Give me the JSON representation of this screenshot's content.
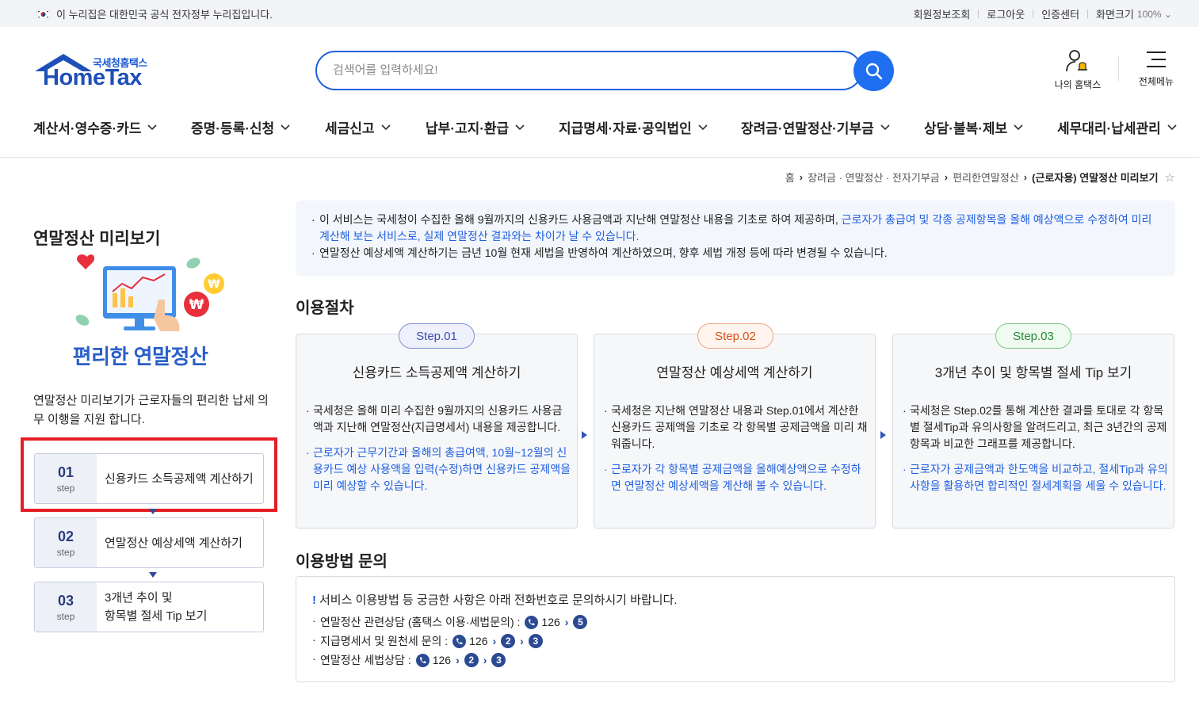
{
  "topbar": {
    "gov_notice": "이 누리집은 대한민국 공식 전자정부 누리집입니다.",
    "links": [
      "회원정보조회",
      "로그아웃",
      "인증센터",
      "화면크기"
    ],
    "zoom": "100%"
  },
  "header": {
    "logo_kr": "국세청홈택스",
    "logo_en": "HomeTax",
    "search_placeholder": "검색어를 입력하세요!",
    "my_label": "나의 홈택스",
    "menu_label": "전체메뉴"
  },
  "gnb": [
    "계산서·영수증·카드",
    "증명·등록·신청",
    "세금신고",
    "납부·고지·환급",
    "지급명세·자료·공익법인",
    "장려금·연말정산·기부금",
    "상담·불복·제보",
    "세무대리·납세관리"
  ],
  "breadcrumb": {
    "home": "홈",
    "level1": "장려금 · 연말정산 · 전자기부금",
    "level2": "편리한연말정산",
    "current": "(근로자용) 연말정산 미리보기"
  },
  "sidebar": {
    "title": "연말정산 미리보기",
    "illustration_title": "편리한 연말정산",
    "description": "연말정산 미리보기가 근로자들의  편리한 납세 의무 이행을 지원 합니다.",
    "steps": [
      {
        "num": "01",
        "unit": "step",
        "label": "신용카드 소득공제액 계산하기"
      },
      {
        "num": "02",
        "unit": "step",
        "label": "연말정산 예상세액 계산하기"
      },
      {
        "num": "03",
        "unit": "step",
        "label_line1": "3개년 추이 및",
        "label_line2": "항목별 절세 Tip 보기"
      }
    ]
  },
  "notice": {
    "line1_a": "이 서비스는 국세청이 수집한 올해 9월까지의 신용카드 사용금액과 지난해 연말정산 내용을 기초로 하여 제공하며, ",
    "line1_b": "근로자가 총급여 및 각종 공제항목을 올해 예상액으로 수정하여 미리 계산해 보는 서비스로, 실제 연말정산 결과와는 차이가 날 수 있습니다.",
    "line2": "연말정산 예상세액 계산하기는 금년 10월 현재 세법을 반영하여 계산하였으며, 향후 세법 개정 등에 따라 변경될 수 있습니다."
  },
  "procedure": {
    "title": "이용절차",
    "cards": [
      {
        "step": "Step.01",
        "title": "신용카드 소득공제액 계산하기",
        "text": "국세청은 올해 미리 수집한 9월까지의 신용카드 사용금액과 지난해 연말정산(지급명세서) 내용을 제공합니다.",
        "blue_text": "근로자가 근무기간과 올해의 총급여액, 10월~12월의 신용카드 예상 사용액을 입력(수정)하면 신용카드 공제액을 미리 예상할 수 있습니다."
      },
      {
        "step": "Step.02",
        "title": "연말정산 예상세액 계산하기",
        "text": "국세청은 지난해 연말정산 내용과 Step.01에서 계산한 신용카드 공제액을 기초로 각 항목별 공제금액을 미리 채워줍니다.",
        "blue_text": "근로자가 각 항목별 공제금액을 올해예상액으로 수정하면 연말정산 예상세액을 계산해 볼 수 있습니다."
      },
      {
        "step": "Step.03",
        "title": "3개년 추이 및 항목별 절세 Tip 보기",
        "text": "국세청은 Step.02를 통해 계산한 결과를 토대로 각 항목별 절세Tip과 유의사항을 알려드리고, 최근 3년간의 공제항목과 비교한 그래프를 제공합니다.",
        "blue_text": "근로자가 공제금액과 한도액을 비교하고, 절세Tip과 유의사항을 활용하면 합리적인 절세계획을 세울 수 있습니다."
      }
    ],
    "colors": {
      "step1": "#5a6fd0",
      "step2": "#e0561f",
      "step3": "#2f9a3a"
    }
  },
  "inquiry": {
    "title": "이용방법 문의",
    "headline": "서비스 이용방법 등 궁금한 사항은 아래 전화번호로 문의하시기 바랍니다.",
    "rows": [
      {
        "label": "연말정산 관련상담 (홈택스 이용·세법문의) :",
        "phone": "126",
        "keys": [
          "5"
        ]
      },
      {
        "label": "지급명세서 및 원천세 문의 :",
        "phone": "126",
        "keys": [
          "2",
          "3"
        ]
      },
      {
        "label": "연말정산 세법상담 :",
        "phone": "126",
        "keys": [
          "2",
          "3"
        ]
      }
    ]
  }
}
